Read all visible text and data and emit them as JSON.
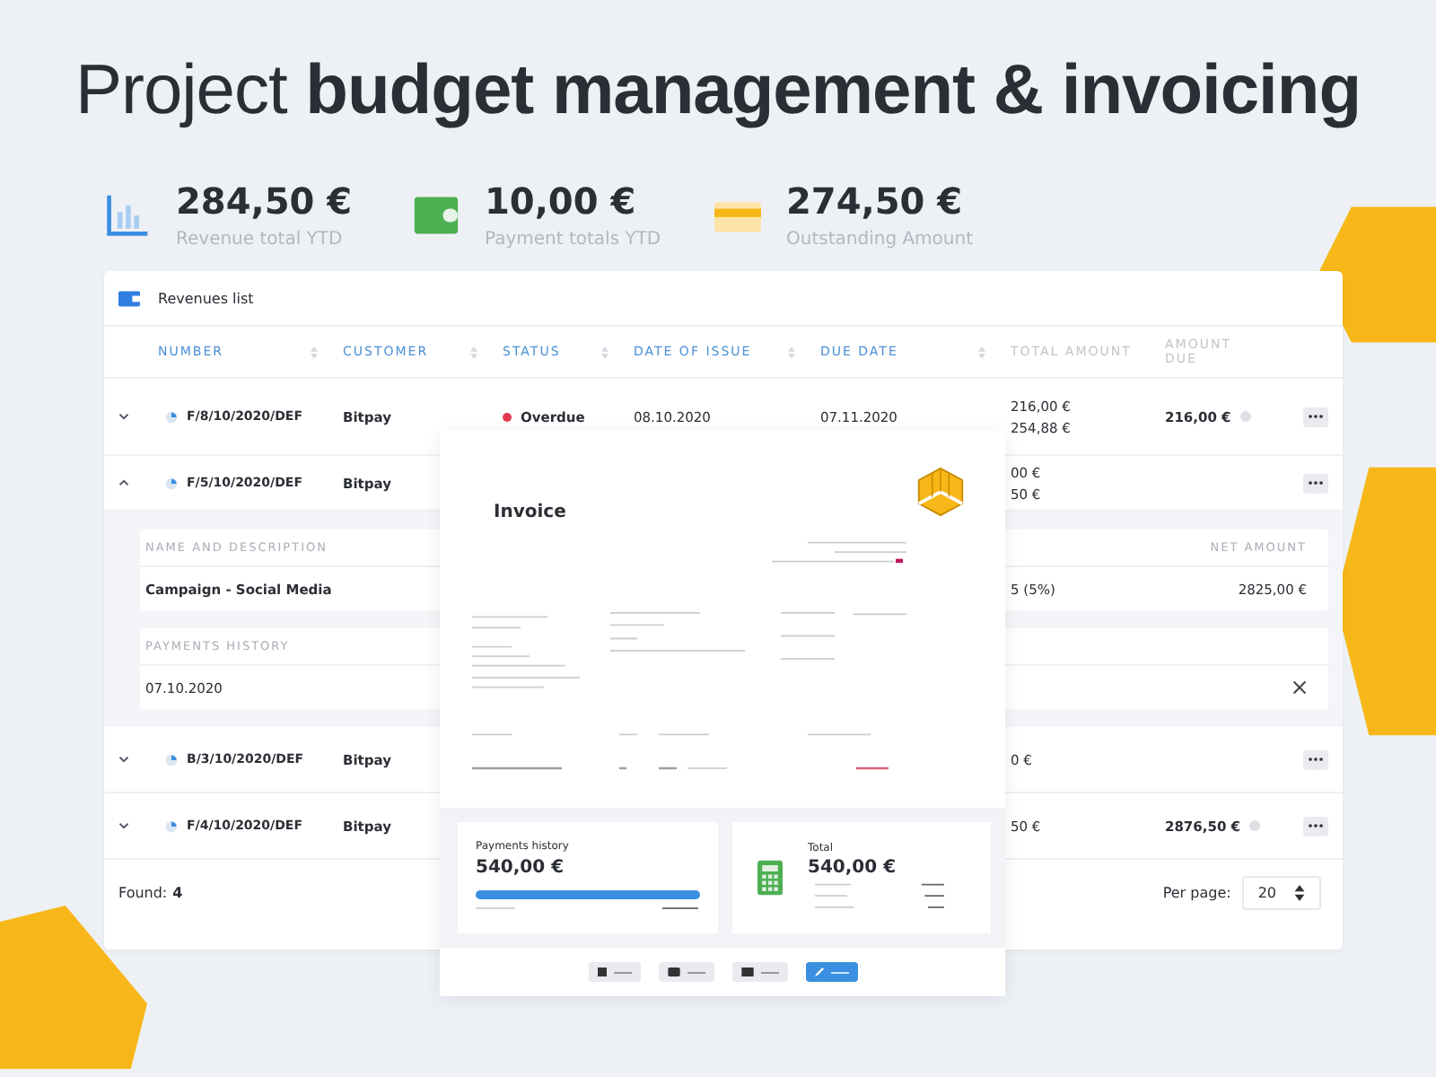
{
  "headline": "Project **budget management & invoicing**",
  "stats": [
    {
      "kind": "chart",
      "value": "284,50 €",
      "label": "Revenue total YTD"
    },
    {
      "kind": "wallet",
      "value": "10,00 €",
      "label": "Payment totals YTD"
    },
    {
      "kind": "card",
      "value": "274,50 €",
      "label": "Outstanding Amount"
    }
  ],
  "revenues_list": {
    "title": "Revenues list",
    "columns": [
      {
        "label": "NUMBER",
        "sortable": true
      },
      {
        "label": "CUSTOMER",
        "sortable": true
      },
      {
        "label": "STATUS",
        "sortable": true
      },
      {
        "label": "DATE OF ISSUE",
        "sortable": true
      },
      {
        "label": "DUE DATE",
        "sortable": true
      },
      {
        "label": "TOTAL AMOUNT",
        "sortable": false
      },
      {
        "label": "AMOUNT DUE",
        "sortable": false
      }
    ],
    "rows": [
      {
        "expanded": false,
        "number": "F/8/10/2020/DEF",
        "customer": "Bitpay",
        "status": "Overdue",
        "date_of_issue": "08.10.2020",
        "due_date": "07.11.2020",
        "total_amount": [
          "216,00 €",
          "254,88 €"
        ],
        "amount_due": "216,00 €"
      },
      {
        "expanded": true,
        "number": "F/5/10/2020/DEF",
        "customer": "Bitpay",
        "total_amount": [
          "00 €",
          "50 €"
        ],
        "details": {
          "name_header": "NAME AND DESCRIPTION",
          "net_header": "NET AMOUNT",
          "name": "Campaign - Social Media",
          "tax": "5 (5%)",
          "net": "2825,00 €",
          "payments_header": "PAYMENTS HISTORY",
          "payment_date": "07.10.2020"
        }
      },
      {
        "expanded": false,
        "number": "B/3/10/2020/DEF",
        "customer": "Bitpay",
        "total_amount": [
          "0 €"
        ]
      },
      {
        "expanded": false,
        "number": "F/4/10/2020/DEF",
        "customer": "Bitpay",
        "total_amount": [
          "50 €"
        ],
        "amount_due": "2876,50 €"
      }
    ],
    "found_label": "Found:",
    "found": "4",
    "per_page_label": "Per page:",
    "per_page": "20"
  },
  "invoice": {
    "title": "Invoice",
    "payments": {
      "label": "Payments history",
      "amount": "540,00 €",
      "level": 1
    },
    "total": {
      "label": "Total",
      "amount": "540,00 €"
    },
    "buttons": [
      {
        "kind": "copy",
        "primary": false
      },
      {
        "kind": "print",
        "primary": false
      },
      {
        "kind": "send",
        "primary": false
      },
      {
        "kind": "edit",
        "primary": true
      }
    ]
  }
}
